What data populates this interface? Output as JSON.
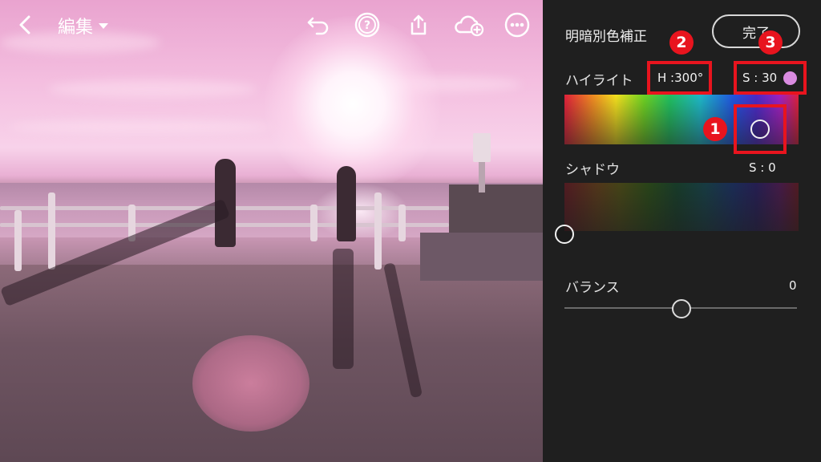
{
  "header": {
    "back_icon": "chevron-left-icon",
    "title": "編集",
    "title_dropdown_icon": "caret-down-icon",
    "undo_icon": "undo-icon",
    "help_icon": "help-icon",
    "share_icon": "share-icon",
    "cloud_icon": "cloud-add-icon",
    "more_icon": "more-icon"
  },
  "panel": {
    "title": "明暗別色補正",
    "done_label": "完了",
    "highlight": {
      "label": "ハイライト",
      "hue_text": "H :300°",
      "sat_text": "S : 30",
      "swatch_color": "#d98be0"
    },
    "shadow": {
      "label": "シャドウ",
      "sat_text": "S : 0"
    },
    "balance": {
      "label": "バランス",
      "value": "0",
      "level": 0.5
    }
  },
  "annotations": {
    "badge1": "1",
    "badge2": "2",
    "badge3": "3",
    "color": "#e8141e"
  }
}
